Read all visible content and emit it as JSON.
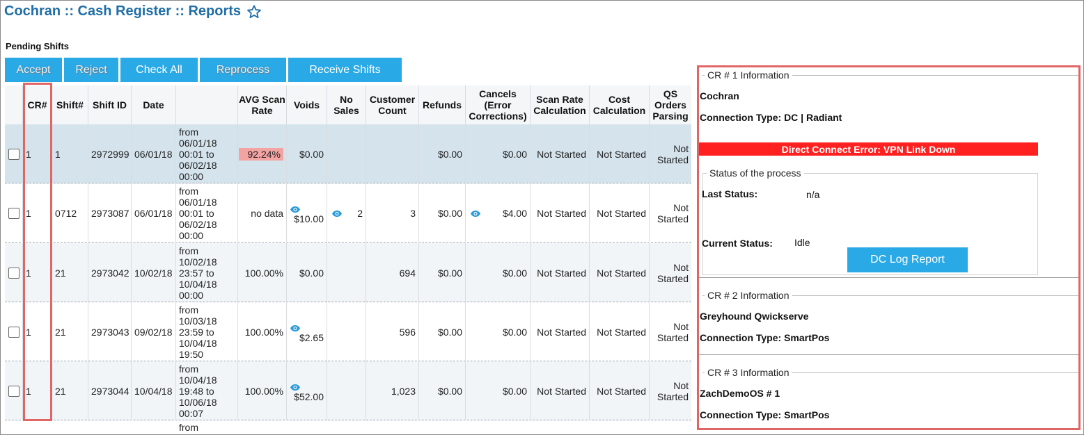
{
  "header": {
    "title": "Cochran :: Cash Register :: Reports"
  },
  "section": {
    "label": "Pending Shifts"
  },
  "toolbar": {
    "accept": "Accept",
    "reject": "Reject",
    "check_all": "Check All",
    "reprocess": "Reprocess",
    "receive_shifts": "Receive Shifts"
  },
  "table": {
    "headers": {
      "cr": "CR#",
      "shift": "Shift#",
      "shift_id": "Shift ID",
      "date": "Date",
      "avg_scan_rate": "AVG Scan Rate",
      "voids": "Voids",
      "no_sales": "No Sales",
      "customer_count": "Customer Count",
      "refunds": "Refunds",
      "cancels": "Cancels (Error Corrections)",
      "scan_rate_calc": "Scan Rate Calculation",
      "cost_calc": "Cost Calculation",
      "qs_orders": "QS Orders Parsing"
    },
    "rows": [
      {
        "cr": "1",
        "shift": "1",
        "shift_id": "2972999",
        "date": "06/01/18",
        "range": "from 06/01/18 00:01 to 06/02/18 00:00",
        "avg": "92.24%",
        "voids": "$0.00",
        "no_sales": "",
        "customers": "",
        "refunds": "$0.00",
        "cancels": "$0.00",
        "scan_calc": "Not Started",
        "cost_calc": "Not Started",
        "qs": "Not Started"
      },
      {
        "cr": "1",
        "shift": "0712",
        "shift_id": "2973087",
        "date": "06/01/18",
        "range": "from 06/01/18 00:01 to 06/02/18 00:00",
        "avg": "no data",
        "voids": "$10.00",
        "no_sales": "2",
        "customers": "3",
        "refunds": "$0.00",
        "cancels": "$4.00",
        "scan_calc": "Not Started",
        "cost_calc": "Not Started",
        "qs": "Not Started"
      },
      {
        "cr": "1",
        "shift": "21",
        "shift_id": "2973042",
        "date": "10/02/18",
        "range": "from 10/02/18 23:57 to 10/04/18 00:00",
        "avg": "100.00%",
        "voids": "$0.00",
        "no_sales": "",
        "customers": "694",
        "refunds": "$0.00",
        "cancels": "$0.00",
        "scan_calc": "Not Started",
        "cost_calc": "Not Started",
        "qs": "Not Started"
      },
      {
        "cr": "1",
        "shift": "21",
        "shift_id": "2973043",
        "date": "09/02/18",
        "range": "from 10/03/18 23:59 to 10/04/18 19:50",
        "avg": "100.00%",
        "voids": "$2.65",
        "no_sales": "",
        "customers": "596",
        "refunds": "$0.00",
        "cancels": "$0.00",
        "scan_calc": "Not Started",
        "cost_calc": "Not Started",
        "qs": "Not Started"
      },
      {
        "cr": "1",
        "shift": "21",
        "shift_id": "2973044",
        "date": "10/04/18",
        "range": "from 10/04/18 19:48 to 10/06/18 00:07",
        "avg": "100.00%",
        "voids": "$52.00",
        "no_sales": "",
        "customers": "1,023",
        "refunds": "$0.00",
        "cancels": "$0.00",
        "scan_calc": "Not Started",
        "cost_calc": "Not Started",
        "qs": "Not Started"
      }
    ],
    "partial_row_text": "from"
  },
  "panel": {
    "cr1": {
      "legend": "CR # 1 Information",
      "name": "Cochran",
      "connection": "Connection Type: DC | Radiant",
      "error": "Direct Connect Error: VPN Link Down",
      "status_legend": "Status of the process",
      "last_status_label": "Last Status:",
      "last_status_value": "n/a",
      "current_status_label": "Current Status:",
      "current_status_value": "Idle",
      "dc_log_button": "DC Log Report"
    },
    "cr2": {
      "legend": "CR # 2 Information",
      "name": "Greyhound Qwickserve",
      "connection": "Connection Type: SmartPos"
    },
    "cr3": {
      "legend": "CR # 3 Information",
      "name": "ZachDemoOS # 1",
      "connection": "Connection Type: SmartPos"
    }
  },
  "colors": {
    "accent": "#29a9e6",
    "title": "#1f6ea6",
    "highlight": "#e06666",
    "error": "#ff2020",
    "selected_row": "#d4e3ec",
    "alt_row": "#f1f5f8"
  }
}
